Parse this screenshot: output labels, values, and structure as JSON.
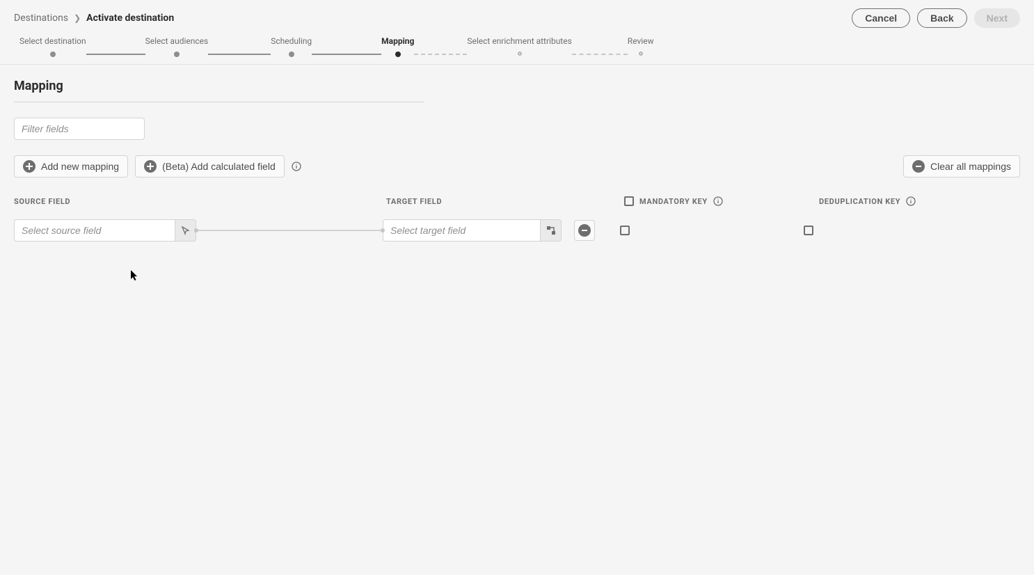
{
  "breadcrumb": {
    "root": "Destinations",
    "current": "Activate destination"
  },
  "actions": {
    "cancel": "Cancel",
    "back": "Back",
    "next": "Next"
  },
  "steps": [
    {
      "label": "Select destination",
      "state": "done"
    },
    {
      "label": "Select audiences",
      "state": "done"
    },
    {
      "label": "Scheduling",
      "state": "done"
    },
    {
      "label": "Mapping",
      "state": "active"
    },
    {
      "label": "Select enrichment attributes",
      "state": "future"
    },
    {
      "label": "Review",
      "state": "future"
    }
  ],
  "page": {
    "title": "Mapping"
  },
  "filter": {
    "placeholder": "Filter fields"
  },
  "toolbar": {
    "add_mapping": "Add new mapping",
    "add_calculated": "(Beta) Add calculated field",
    "clear_all": "Clear all mappings"
  },
  "columns": {
    "source": "SOURCE FIELD",
    "target": "TARGET FIELD",
    "mandatory": "MANDATORY KEY",
    "dedup": "DEDUPLICATION KEY"
  },
  "mapping_rows": [
    {
      "source_placeholder": "Select source field",
      "target_placeholder": "Select target field",
      "mandatory": false,
      "dedup": false
    }
  ]
}
